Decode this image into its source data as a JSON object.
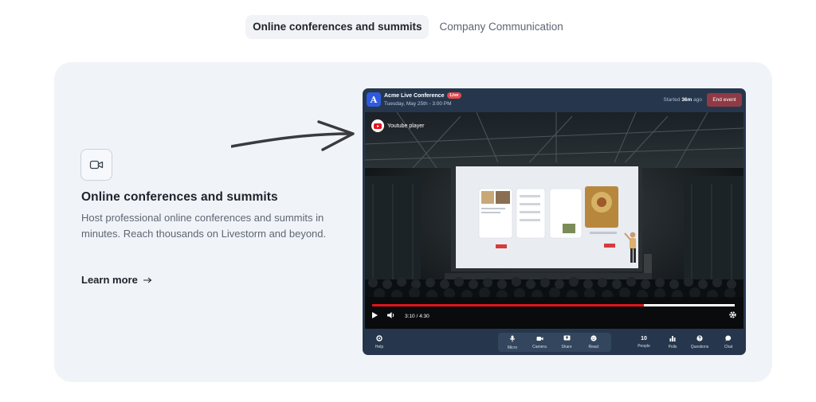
{
  "tabs": [
    {
      "label": "Online conferences and summits",
      "active": true
    },
    {
      "label": "Company Communication",
      "active": false
    }
  ],
  "feature": {
    "icon": "video-camera-icon",
    "title": "Online conferences and summits",
    "description": "Host professional online conferences and summits in minutes. Reach thousands on Livestorm and beyond.",
    "link_label": "Learn more"
  },
  "app": {
    "avatar_letter": "A",
    "title": "Acme Live Conference",
    "live_badge": "Live",
    "date": "Tuesday, May 25th - 3:00 PM",
    "started_prefix": "Started",
    "started_value": "36m",
    "started_suffix": "ago",
    "end_button": "End event",
    "player_label": "Youtube player",
    "time": "3:10 / 4:30",
    "progress": 0.75,
    "toolbar": {
      "help": "Help",
      "micro": "Micro",
      "camera": "Camera",
      "share": "Share",
      "react": "React",
      "people_count": "10",
      "people": "People",
      "polls": "Polls",
      "questions": "Questions",
      "chat": "Chat"
    }
  },
  "colors": {
    "accent_red": "#e2141b",
    "app_bg": "#26374d",
    "end_button": "#8f3a45",
    "card_bg": "#f0f4f8"
  }
}
